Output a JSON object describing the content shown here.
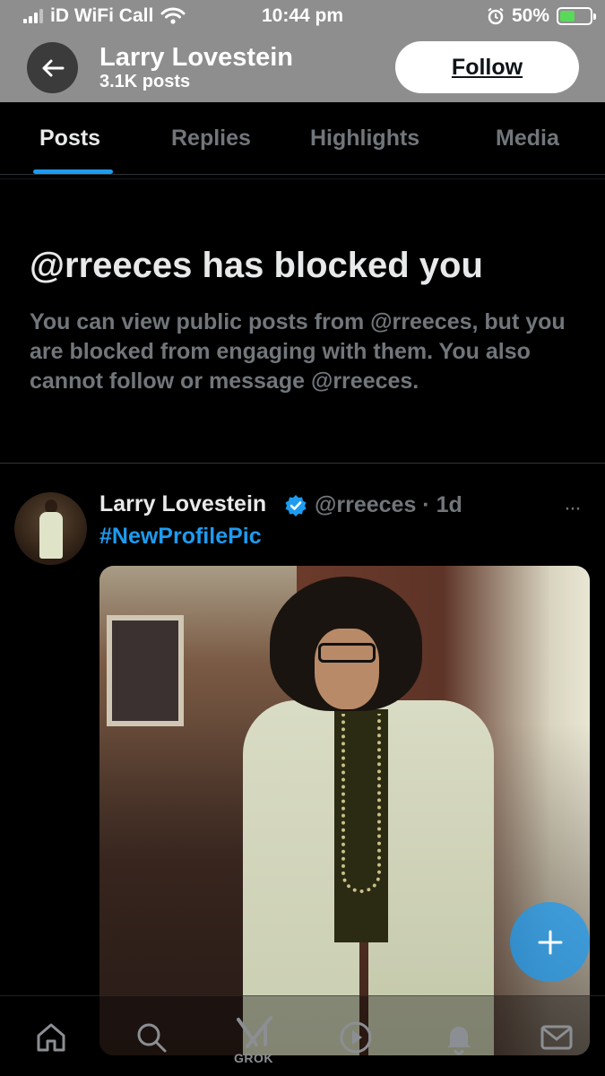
{
  "status_bar": {
    "carrier": "iD WiFi Call",
    "time": "10:44 pm",
    "battery": "50%",
    "battery_level": 0.5
  },
  "header": {
    "title": "Larry Lovestein",
    "subtitle": "3.1K posts",
    "follow_label": "Follow"
  },
  "tabs": [
    {
      "label": "Posts",
      "active": true
    },
    {
      "label": "Replies",
      "active": false
    },
    {
      "label": "Highlights",
      "active": false
    },
    {
      "label": "Media",
      "active": false
    }
  ],
  "blocked": {
    "title": "@rreeces has blocked you",
    "body": "You can view public posts from @rreeces, but you are blocked from engaging with them. You also cannot follow or message @rreeces."
  },
  "post": {
    "name": "Larry Lovestein",
    "handle_time": "@rreeces · 1d",
    "text": "#NewProfilePic",
    "more": "···"
  },
  "bottom_nav": {
    "grok_label": "GROK",
    "items": [
      "home-icon",
      "search-icon",
      "grok-icon",
      "play-icon",
      "notifications-icon",
      "messages-icon"
    ]
  },
  "colors": {
    "accent": "#1d9bf0",
    "muted": "#71767b",
    "background": "#000000"
  }
}
